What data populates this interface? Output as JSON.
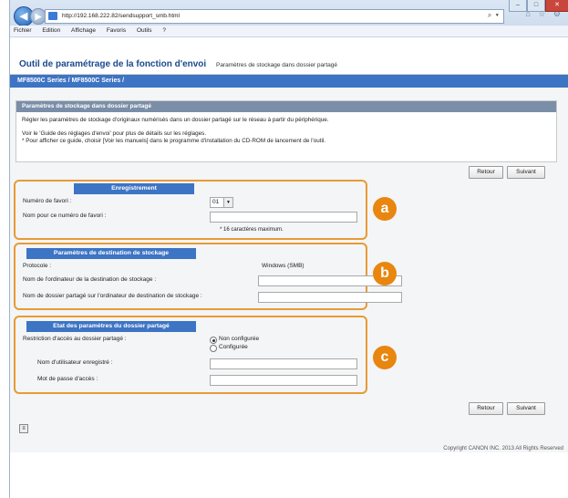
{
  "browser": {
    "url": "http://192.168.222.82/sendsupport_smb.html",
    "search_glyph": "⌕ ▾",
    "tab_tools": "⌂ ☆ ⚙",
    "menu": [
      "Fichier",
      "Edition",
      "Affichage",
      "Favoris",
      "Outils",
      "?"
    ]
  },
  "app": {
    "title": "Outil de paramétrage de la fonction d'envoi",
    "subtitle": "Paramètres de stockage dans dossier partagé",
    "breadcrumb": "MF8500C Series / MF8500C Series /"
  },
  "info": {
    "heading": "Paramètres de stockage dans dossier partagé",
    "line1": "Régler les paramètres de stockage d'originaux numérisés dans un dossier partagé sur le réseau à partir du périphérique.",
    "line2": "Voir le 'Guide des réglages d'envoi' pour plus de détails sur les réglages.",
    "line3": "* Pour afficher ce guide, choisir [Voir les manuels] dans le programme d'installation du CD-ROM de lancement de l'outil."
  },
  "buttons": {
    "back": "Retour",
    "next": "Suivant"
  },
  "registration": {
    "heading": "Enregistrement",
    "fav_number_label": "Numéro de favori :",
    "fav_number_value": "01",
    "fav_name_label": "Nom pour ce numéro de favori :",
    "fav_name_note": "* 16 caractères maximum."
  },
  "destination": {
    "heading": "Paramètres de destination de stockage",
    "protocol_label": "Protocole :",
    "protocol_value": "Windows (SMB)",
    "computer_name_label": "Nom de l'ordinateur de la destination de stockage :",
    "shared_folder_label": "Nom de dossier partagé sur l'ordinateur de destination de stockage :"
  },
  "shared_status": {
    "heading": "Etat des paramètres du dossier partagé",
    "restriction_label": "Restriction d'accès au dossier partagé :",
    "option_off": "Non configurée",
    "option_on": "Configurée",
    "username_label": "Nom d'utilisateur enregistré :",
    "password_label": "Mot de passe d'accès :"
  },
  "badges": {
    "a": "a",
    "b": "b",
    "c": "c"
  },
  "copyright": "Copyright CANON INC. 2013 All Rights Reserved",
  "colors": {
    "accent": "#3d74c4",
    "highlight": "#e89a35",
    "title": "#1a4a8e"
  }
}
